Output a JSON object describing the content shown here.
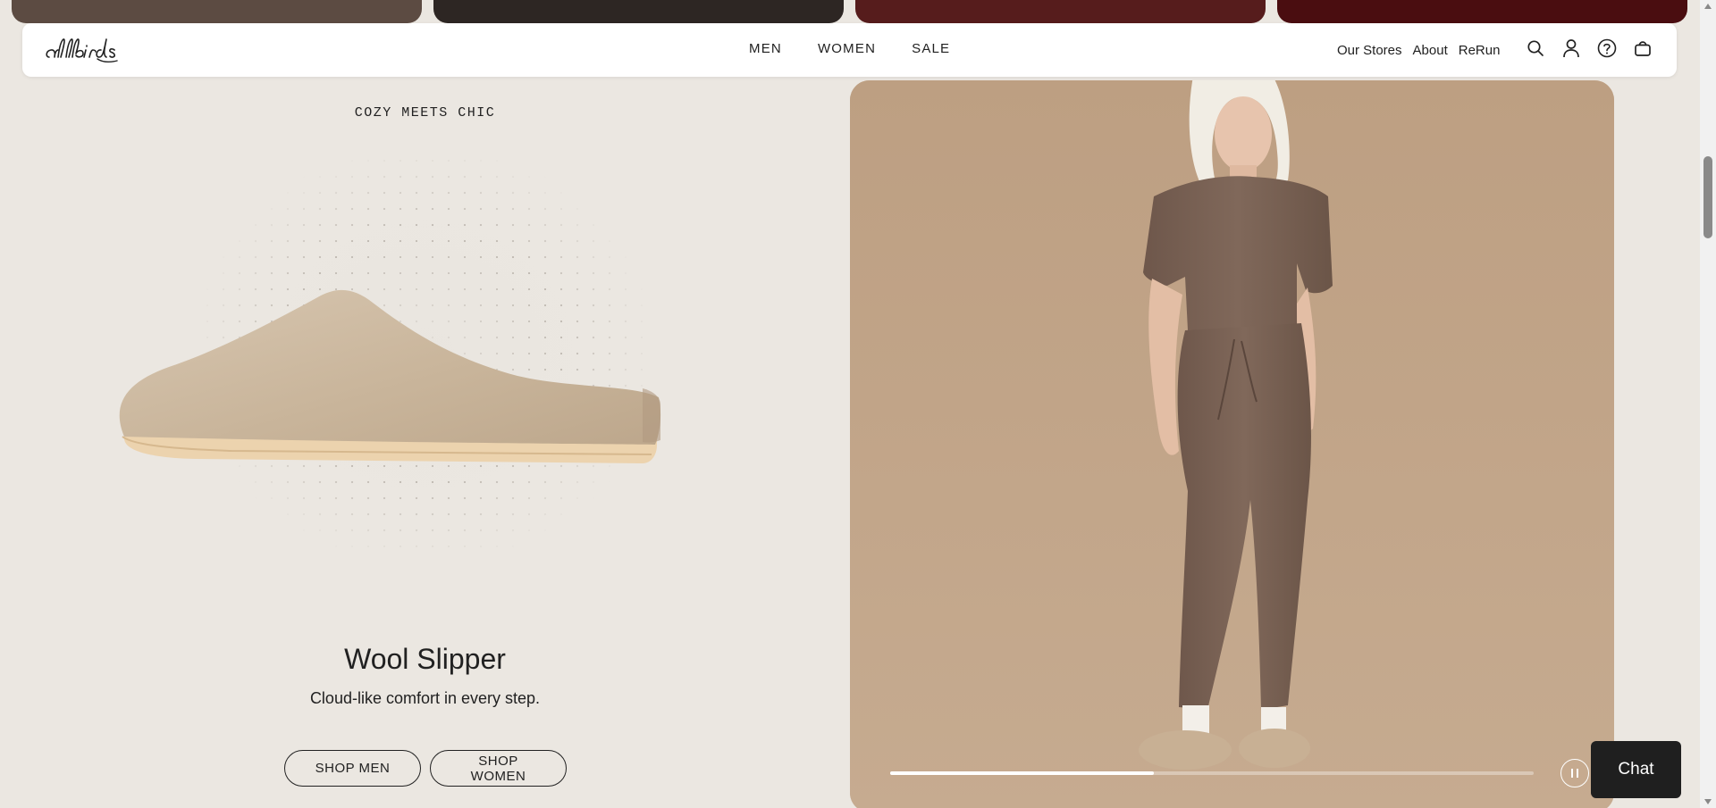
{
  "header": {
    "logo_text": "allbirds",
    "nav": [
      "MEN",
      "WOMEN",
      "SALE"
    ],
    "links": [
      "Our Stores",
      "About",
      "ReRun"
    ],
    "icons": [
      "search-icon",
      "account-icon",
      "help-icon",
      "cart-icon"
    ]
  },
  "feature": {
    "eyebrow": "COZY MEETS CHIC",
    "title": "Wool Slipper",
    "subtitle": "Cloud-like comfort in every step.",
    "shop_men": "SHOP MEN",
    "shop_women": "SHOP WOMEN"
  },
  "hero": {
    "progress": 0.41
  },
  "chat": {
    "label": "Chat"
  },
  "colors": {
    "page_bg": "#ebe7e1",
    "hero_bg": "#c0a488",
    "text": "#212121"
  }
}
